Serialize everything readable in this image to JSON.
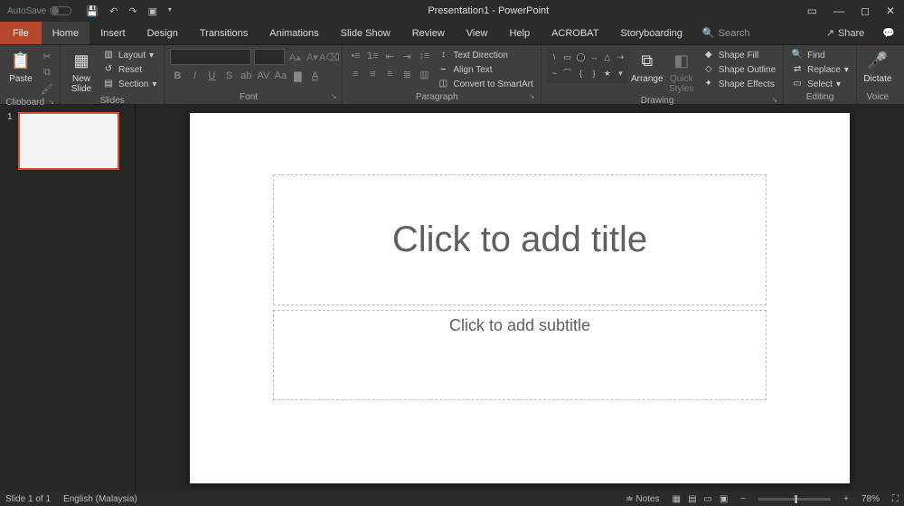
{
  "titlebar": {
    "autosave_label": "AutoSave",
    "title": "Presentation1 - PowerPoint"
  },
  "tabs": {
    "file": "File",
    "items": [
      "Home",
      "Insert",
      "Design",
      "Transitions",
      "Animations",
      "Slide Show",
      "Review",
      "View",
      "Help",
      "ACROBAT",
      "Storyboarding"
    ],
    "active": "Home",
    "search_placeholder": "Search",
    "share": "Share"
  },
  "ribbon": {
    "clipboard": {
      "paste": "Paste",
      "label": "Clipboard"
    },
    "slides": {
      "new_slide": "New\nSlide",
      "layout": "Layout",
      "reset": "Reset",
      "section": "Section",
      "label": "Slides"
    },
    "font": {
      "label": "Font"
    },
    "paragraph": {
      "label": "Paragraph",
      "text_direction": "Text Direction",
      "align_text": "Align Text",
      "convert": "Convert to SmartArt"
    },
    "drawing": {
      "arrange": "Arrange",
      "quick": "Quick\nStyles",
      "shape_fill": "Shape Fill",
      "shape_outline": "Shape Outline",
      "shape_effects": "Shape Effects",
      "label": "Drawing"
    },
    "editing": {
      "find": "Find",
      "replace": "Replace",
      "select": "Select",
      "label": "Editing"
    },
    "voice": {
      "dictate": "Dictate",
      "label": "Voice"
    }
  },
  "thumbnails": {
    "first_num": "1"
  },
  "slide": {
    "title_placeholder": "Click to add title",
    "subtitle_placeholder": "Click to add subtitle"
  },
  "status": {
    "slide_of": "Slide 1 of 1",
    "language": "English (Malaysia)",
    "notes": "Notes",
    "zoom": "78%"
  }
}
